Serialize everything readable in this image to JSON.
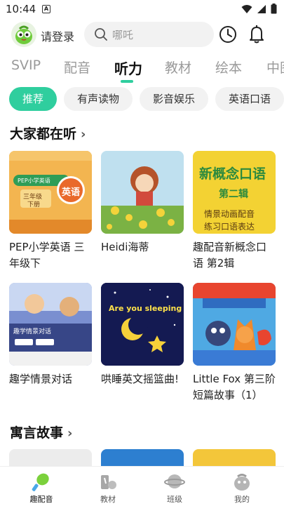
{
  "status_bar": {
    "time": "10:44",
    "sim_label": "A"
  },
  "header": {
    "login_label": "请登录",
    "search_placeholder": "哪吒"
  },
  "tabs": [
    "SVIP",
    "配音",
    "听力",
    "教材",
    "绘本",
    "中图"
  ],
  "active_tab": "听力",
  "chips": [
    "推荐",
    "有声读物",
    "影音娱乐",
    "英语口语"
  ],
  "active_chip": "推荐",
  "sections": [
    {
      "title": "大家都在听",
      "items": [
        {
          "title": "PEP小学英语 三年级下",
          "cover_text": [
            "PEP小学英语",
            "三年级",
            "下册",
            "英语"
          ]
        },
        {
          "title": "Heidi海蒂",
          "cover_text": []
        },
        {
          "title": "趣配音新概念口语 第2辑",
          "cover_text": [
            "新概念口语",
            "第二辑",
            "情景动画配音",
            "练习口语表达"
          ]
        },
        {
          "title": "趣学情景对话",
          "cover_text": [
            "趣学情景对话"
          ]
        },
        {
          "title": "哄睡英文摇篮曲!",
          "cover_text": [
            "Are you sleeping"
          ]
        },
        {
          "title": "Little Fox 第三阶短篇故事（1）",
          "cover_text": []
        }
      ]
    },
    {
      "title": "寓言故事",
      "items": []
    }
  ],
  "bottom_nav": [
    {
      "label": "趣配音",
      "icon": "microphone-icon",
      "active": true
    },
    {
      "label": "教材",
      "icon": "books-icon",
      "active": false
    },
    {
      "label": "班级",
      "icon": "planet-icon",
      "active": false
    },
    {
      "label": "我的",
      "icon": "profile-icon",
      "active": false
    }
  ],
  "colors": {
    "accent": "#2fce9e",
    "cover_orange": "#f0a33c",
    "cover_yellow": "#f3d233",
    "cover_navy": "#10164a"
  }
}
